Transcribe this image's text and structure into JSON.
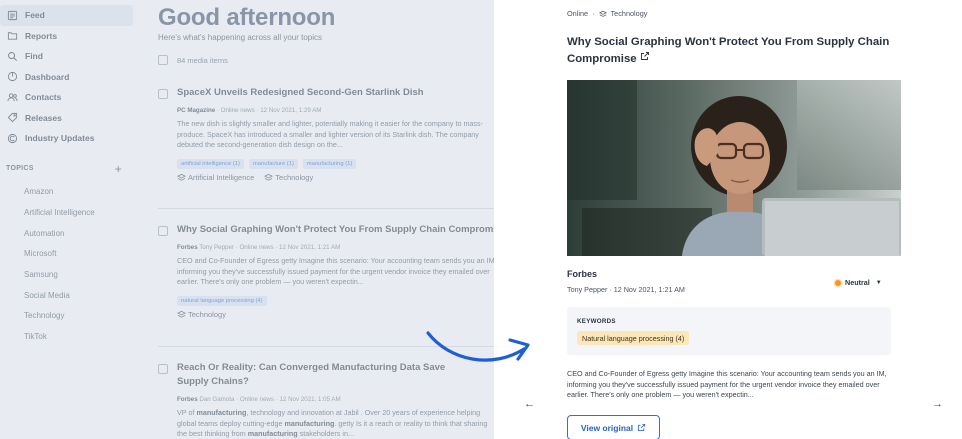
{
  "sidebar": {
    "nav": [
      {
        "label": "Feed",
        "icon": "feed-icon",
        "active": true
      },
      {
        "label": "Reports",
        "icon": "folder-icon"
      },
      {
        "label": "Find",
        "icon": "search-icon"
      },
      {
        "label": "Dashboard",
        "icon": "dashboard-icon"
      },
      {
        "label": "Contacts",
        "icon": "contacts-icon"
      },
      {
        "label": "Releases",
        "icon": "releases-icon"
      },
      {
        "label": "Industry Updates",
        "icon": "industry-icon"
      }
    ],
    "topics_heading": "TOPICS",
    "topics_add": "+",
    "topics": [
      "Amazon",
      "Artificial Intelligence",
      "Automation",
      "Microsoft",
      "Samsung",
      "Social Media",
      "Technology",
      "TikTok"
    ]
  },
  "feed": {
    "greeting": "Good afternoon",
    "subtitle": "Here's what's happening across all your topics",
    "count": "84 media items",
    "articles": [
      {
        "title": "SpaceX Unveils Redesigned Second-Gen Starlink Dish",
        "source": "PC Magazine",
        "meta": " · Online news · 12 Nov 2021, 1:29 AM",
        "body": "The new dish is slightly smaller and lighter, potentially making it easier for the company to mass-produce. SpaceX has introduced a smaller and lighter version of its Starlink dish. The company debuted the second-generation dish design on the...",
        "tags": [
          "artificial intelligence (1)",
          "manufacture (1)",
          "manufacturing (1)"
        ],
        "categories": [
          "Artificial Intelligence",
          "Technology"
        ]
      },
      {
        "title": "Why Social Graphing Won't Protect You From Supply Chain Compromise",
        "source": "Forbes",
        "meta": "  Tony Pepper · Online news · 12 Nov 2021, 1:21 AM",
        "body": "CEO and Co-Founder of Egress getty Imagine this scenario: Your accounting team sends you an IM, informing you they've successfully issued payment for the urgent vendor invoice they emailed over earlier. There's only one problem — you weren't expectin...",
        "tags": [
          "natural language processing (4)"
        ],
        "categories": [
          "Technology"
        ]
      },
      {
        "title": "Reach Or Reality: Can Converged Manufacturing Data Save Supply Chains?",
        "source": "Forbes",
        "meta": "  Dan Gamota · Online news · 12 Nov 2021, 1:05 AM",
        "body_pre": "VP of ",
        "body_b1": "manufacturing",
        "body_mid": ", technology and innovation at Jabil . Over 20 years of experience helping global teams deploy cutting-edge ",
        "body_b2": "manufacturing",
        "body_mid2": ". getty Is it a reach or reality to think that sharing the best thinking from ",
        "body_b3": "manufacturing",
        "body_end": " stakeholders in..."
      }
    ]
  },
  "detail": {
    "breadcrumb_type": "Online",
    "breadcrumb_sep": "·",
    "breadcrumb_topic": "Technology",
    "title": "Why Social Graphing Won't Protect You From Supply Chain Compromise",
    "source": "Forbes",
    "byline": "Tony Pepper · 12 Nov 2021, 1:21 AM",
    "sentiment": "Neutral",
    "sentiment_color": "#f29a1f",
    "keywords_label": "KEYWORDS",
    "keywords": [
      "Natural language processing (4)"
    ],
    "excerpt": "CEO and Co-Founder of Egress getty Imagine this scenario: Your accounting team sends you an IM, informing you they've successfully issued payment for the urgent vendor invoice they emailed over earlier. There's only one problem — you weren't expectin...",
    "view_original": "View original",
    "prev_arrow": "←",
    "next_arrow": "→"
  },
  "colors": {
    "accent": "#2d6fe0",
    "tag_bg": "#dde8fb",
    "keyword_bg": "#fde7b8",
    "annotation_arrow": "#1f5fd6"
  }
}
